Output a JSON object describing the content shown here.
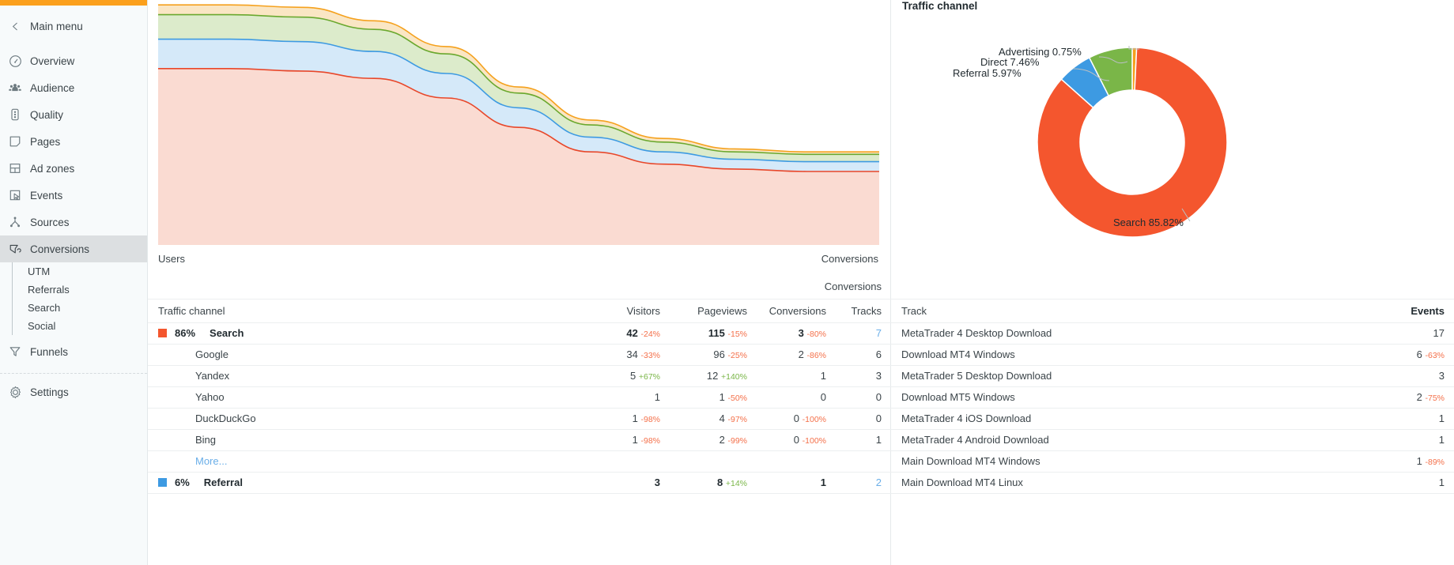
{
  "sidebar": {
    "back_label": "Main menu",
    "items": [
      {
        "label": "Overview",
        "icon": "gauge-icon",
        "active": false
      },
      {
        "label": "Audience",
        "icon": "people-icon",
        "active": false
      },
      {
        "label": "Quality",
        "icon": "traffic-light-icon",
        "active": false
      },
      {
        "label": "Pages",
        "icon": "page-icon",
        "active": false
      },
      {
        "label": "Ad zones",
        "icon": "layout-icon",
        "active": false
      },
      {
        "label": "Events",
        "icon": "cursor-click-icon",
        "active": false
      },
      {
        "label": "Sources",
        "icon": "sitemap-icon",
        "active": false
      },
      {
        "label": "Conversions",
        "icon": "funnel-page-icon",
        "active": true
      }
    ],
    "subitems": [
      "UTM",
      "Referrals",
      "Search",
      "Social"
    ],
    "funnels_label": "Funnels",
    "settings_label": "Settings"
  },
  "chart_panel": {
    "left_axis_label": "Users",
    "right_axis_label": "Conversions"
  },
  "donut": {
    "title": "Traffic channel",
    "labels": {
      "advertising": "Advertising 0.75%",
      "direct": "Direct 7.46%",
      "referral": "Referral 5.97%",
      "search": "Search 85.82%"
    }
  },
  "chart_data": [
    {
      "type": "area",
      "title": "Users / Conversions over time",
      "xlabel": "",
      "ylabel": "Users",
      "y2label": "Conversions",
      "stacked": true,
      "grid": false,
      "legend": "none",
      "x": [
        0,
        1,
        2,
        3,
        4,
        5,
        6,
        7,
        8,
        9,
        10
      ],
      "series": [
        {
          "name": "Search",
          "color": "#e8472a",
          "fill": "#fadbd2",
          "values": [
            72,
            72,
            71,
            68,
            60,
            48,
            38,
            33,
            31,
            30,
            30
          ]
        },
        {
          "name": "Referral",
          "color": "#3d9ae2",
          "fill": "#d5e9f9",
          "values": [
            12,
            12,
            12,
            11,
            10,
            8,
            6,
            5,
            4,
            4,
            4
          ]
        },
        {
          "name": "Direct",
          "color": "#6aa82e",
          "fill": "#dcebcb",
          "values": [
            10,
            10,
            10,
            9,
            8,
            6,
            5,
            4,
            3,
            3,
            3
          ]
        },
        {
          "name": "Advertising",
          "color": "#f5a11d",
          "fill": "#fae6c4",
          "values": [
            4,
            4,
            4,
            3.5,
            3,
            2.5,
            2,
            1.5,
            1.2,
            1,
            1
          ]
        }
      ],
      "ylim": [
        0,
        100
      ]
    },
    {
      "type": "pie",
      "subtype": "donut",
      "title": "Traffic channel",
      "labels": [
        "Search",
        "Direct",
        "Referral",
        "Advertising"
      ],
      "values": [
        85.82,
        7.46,
        5.97,
        0.75
      ],
      "colors": [
        "#f4562e",
        "#7ab648",
        "#3d9ae2",
        "#f5a11d"
      ],
      "value_suffix": "%",
      "legend": "callouts"
    }
  ],
  "left_table": {
    "group_header": "Conversions",
    "columns": [
      "Traffic channel",
      "Visitors",
      "Pageviews",
      "Conversions",
      "Tracks"
    ],
    "rows": [
      {
        "kind": "group",
        "swatch": "#f4562e",
        "pct": "86%",
        "name": "Search",
        "visitors": "42",
        "visitors_delta": "-24%",
        "visitors_delta_sign": "neg",
        "pageviews": "115",
        "pageviews_delta": "-15%",
        "pageviews_delta_sign": "neg",
        "conversions": "3",
        "conversions_delta": "-80%",
        "conversions_delta_sign": "neg",
        "tracks": "7",
        "tracks_link": true
      },
      {
        "kind": "child",
        "name": "Google",
        "visitors": "34",
        "visitors_delta": "-33%",
        "visitors_delta_sign": "neg",
        "pageviews": "96",
        "pageviews_delta": "-25%",
        "pageviews_delta_sign": "neg",
        "conversions": "2",
        "conversions_delta": "-86%",
        "conversions_delta_sign": "neg",
        "tracks": "6",
        "tracks_link": false
      },
      {
        "kind": "child",
        "name": "Yandex",
        "visitors": "5",
        "visitors_delta": "+67%",
        "visitors_delta_sign": "pos",
        "pageviews": "12",
        "pageviews_delta": "+140%",
        "pageviews_delta_sign": "pos",
        "conversions": "1",
        "conversions_delta": "",
        "conversions_delta_sign": "",
        "tracks": "3",
        "tracks_link": false
      },
      {
        "kind": "child",
        "name": "Yahoo",
        "visitors": "1",
        "visitors_delta": "",
        "visitors_delta_sign": "",
        "pageviews": "1",
        "pageviews_delta": "-50%",
        "pageviews_delta_sign": "neg",
        "conversions": "0",
        "conversions_delta": "",
        "conversions_delta_sign": "",
        "tracks": "0",
        "tracks_link": false
      },
      {
        "kind": "child",
        "name": "DuckDuckGo",
        "visitors": "1",
        "visitors_delta": "-98%",
        "visitors_delta_sign": "neg",
        "pageviews": "4",
        "pageviews_delta": "-97%",
        "pageviews_delta_sign": "neg",
        "conversions": "0",
        "conversions_delta": "-100%",
        "conversions_delta_sign": "neg",
        "tracks": "0",
        "tracks_link": false
      },
      {
        "kind": "child",
        "name": "Bing",
        "visitors": "1",
        "visitors_delta": "-98%",
        "visitors_delta_sign": "neg",
        "pageviews": "2",
        "pageviews_delta": "-99%",
        "pageviews_delta_sign": "neg",
        "conversions": "0",
        "conversions_delta": "-100%",
        "conversions_delta_sign": "neg",
        "tracks": "1",
        "tracks_link": false
      },
      {
        "kind": "more",
        "name": "More..."
      },
      {
        "kind": "group",
        "swatch": "#3d9ae2",
        "pct": "6%",
        "name": "Referral",
        "visitors": "3",
        "visitors_delta": "",
        "visitors_delta_sign": "",
        "pageviews": "8",
        "pageviews_delta": "+14%",
        "pageviews_delta_sign": "pos",
        "conversions": "1",
        "conversions_delta": "",
        "conversions_delta_sign": "",
        "tracks": "2",
        "tracks_link": true
      }
    ]
  },
  "right_table": {
    "columns": [
      "Track",
      "Events"
    ],
    "rows": [
      {
        "track": "MetaTrader 4 Desktop Download",
        "events": "17",
        "delta": "",
        "delta_sign": ""
      },
      {
        "track": "Download MT4 Windows",
        "events": "6",
        "delta": "-63%",
        "delta_sign": "neg"
      },
      {
        "track": "MetaTrader 5 Desktop Download",
        "events": "3",
        "delta": "",
        "delta_sign": ""
      },
      {
        "track": "Download MT5 Windows",
        "events": "2",
        "delta": "-75%",
        "delta_sign": "neg"
      },
      {
        "track": "MetaTrader 4 iOS Download",
        "events": "1",
        "delta": "",
        "delta_sign": ""
      },
      {
        "track": "MetaTrader 4 Android Download",
        "events": "1",
        "delta": "",
        "delta_sign": ""
      },
      {
        "track": "Main Download MT4 Windows",
        "events": "1",
        "delta": "-89%",
        "delta_sign": "neg"
      },
      {
        "track": "Main Download MT4 Linux",
        "events": "1",
        "delta": "",
        "delta_sign": ""
      }
    ]
  }
}
